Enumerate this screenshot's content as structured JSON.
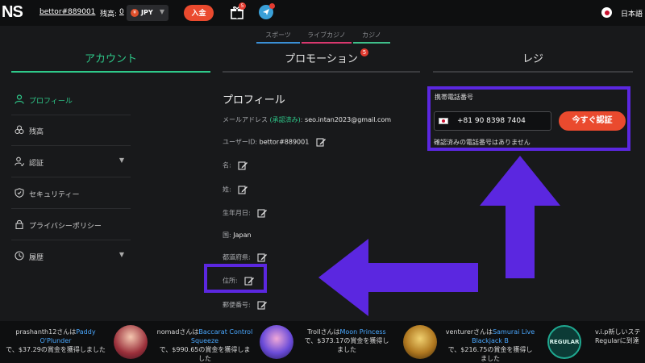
{
  "header": {
    "logo": "NS",
    "username": "bettor#889001",
    "balance_label": "残高:",
    "balance_value": "0",
    "currency": "JPY",
    "currency_coin": "¥",
    "deposit_label": "入金",
    "gift_badge": "5",
    "language": "日本語"
  },
  "subnav": {
    "sports": "スポーツ",
    "live": "ライブカジノ",
    "casino": "カジノ"
  },
  "tabs": {
    "account": "アカウント",
    "promotion": "プロモーション",
    "promotion_badge": "5",
    "cashier": "レジ"
  },
  "sidebar": {
    "items": [
      {
        "label": "プロフィール",
        "icon": "user-icon"
      },
      {
        "label": "残高",
        "icon": "coins-icon"
      },
      {
        "label": "認証",
        "icon": "verify-icon"
      },
      {
        "label": "セキュリティー",
        "icon": "shield-icon"
      },
      {
        "label": "プライバシーポリシー",
        "icon": "lock-icon"
      },
      {
        "label": "履歴",
        "icon": "history-icon"
      }
    ]
  },
  "profile": {
    "title": "プロフィール",
    "email_label": "メールアドレス",
    "email_status": "(承認済み)",
    "email_value": "seo.intan2023@gmail.com",
    "userid_label": "ユーザーID:",
    "userid_value": "bettor#889001",
    "first_name_label": "名:",
    "last_name_label": "姓:",
    "birthdate_label": "生年月日:",
    "country_label": "国:",
    "country_value": "Japan",
    "prefecture_label": "都道府県:",
    "address_label": "住所:",
    "postal_label": "郵便番号:"
  },
  "phone": {
    "label": "携帯電話番号",
    "value": "+81 90 8398 7404",
    "verify_label": "今すぐ認証",
    "no_verified": "確認済みの電話番号はありません"
  },
  "ticker": [
    {
      "pre": "prashanth12さんは",
      "game": "Paddy O'Plunder",
      "post": "で、$37.29の賞金を獲得しました"
    },
    {
      "pre": "nomadさんは",
      "game": "Baccarat Control Squeeze",
      "post": "で、$990.65の賞金を獲得しました"
    },
    {
      "pre": "Trollさんは",
      "game": "Moon Princess",
      "post": "で、$373.17の賞金を獲得しました"
    },
    {
      "pre": "venturerさんは",
      "game": "Samurai Live Blackjack B",
      "post": "で、$216.75の賞金を獲得しました"
    },
    {
      "pre": "v.i.p新しいステ",
      "game": "",
      "post": "Regularに到達"
    }
  ],
  "ticker_thumb_4": "REGULAR",
  "colors": {
    "accent": "#2ec98a",
    "deposit": "#ea4a2e",
    "annotation": "#5b27e0"
  }
}
